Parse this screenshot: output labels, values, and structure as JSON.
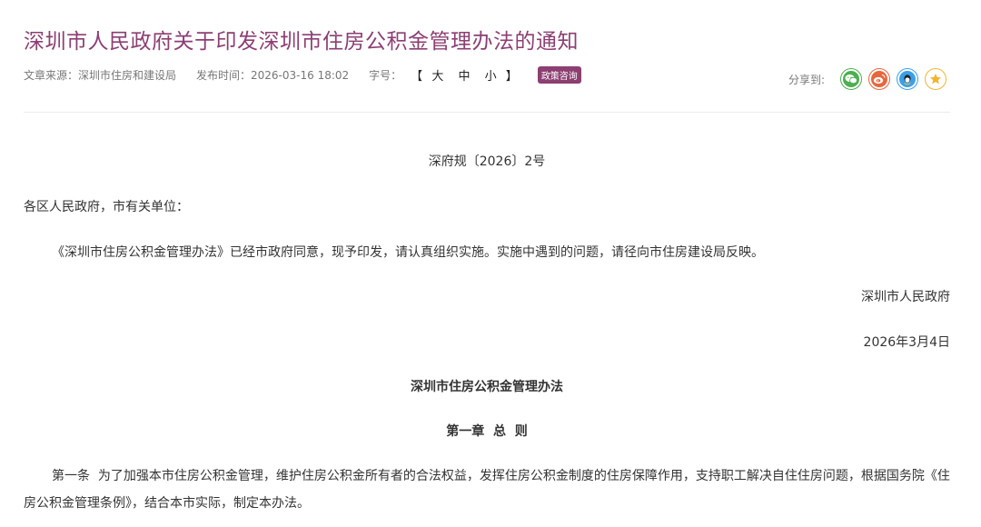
{
  "article": {
    "title": "深圳市人民政府关于印发深圳市住房公积金管理办法的通知",
    "meta": {
      "source": "文章来源：深圳市住房和建设局",
      "time": "发布时间：2026-03-16 18:02",
      "size_label": "字号：",
      "bracket_open": "【",
      "size_large": "大",
      "size_medium": "中",
      "size_small": "小",
      "bracket_close": "】",
      "badge": "政策咨询"
    },
    "share": {
      "label": "分享到:",
      "buttons": [
        {
          "icon": "wechat-icon",
          "color": "#4caf50"
        },
        {
          "icon": "weibo-icon",
          "color": "#e8663d"
        },
        {
          "icon": "qq-icon",
          "color": "#3aa0e8"
        },
        {
          "icon": "favorite-star-icon",
          "color": "#f2b431"
        }
      ]
    }
  },
  "content": {
    "doc_number": "深府规〔2026〕2号",
    "salutation": "各区人民政府，市有关单位：",
    "intro": "《深圳市住房公积金管理办法》已经市政府同意，现予印发，请认真组织实施。实施中遇到的问题，请径向市住房建设局反映。",
    "issuer": "深圳市人民政府",
    "date": "2026年3月4日",
    "doc_title": "深圳市住房公积金管理办法",
    "chapter": "第一章  总  则",
    "article_1": "第一条  为了加强本市住房公积金管理，维护住房公积金所有者的合法权益，发挥住房公积金制度的住房保障作用，支持职工解决自住住房问题，根据国务院《住房公积金管理条例》，结合本市实际，制定本办法。"
  }
}
